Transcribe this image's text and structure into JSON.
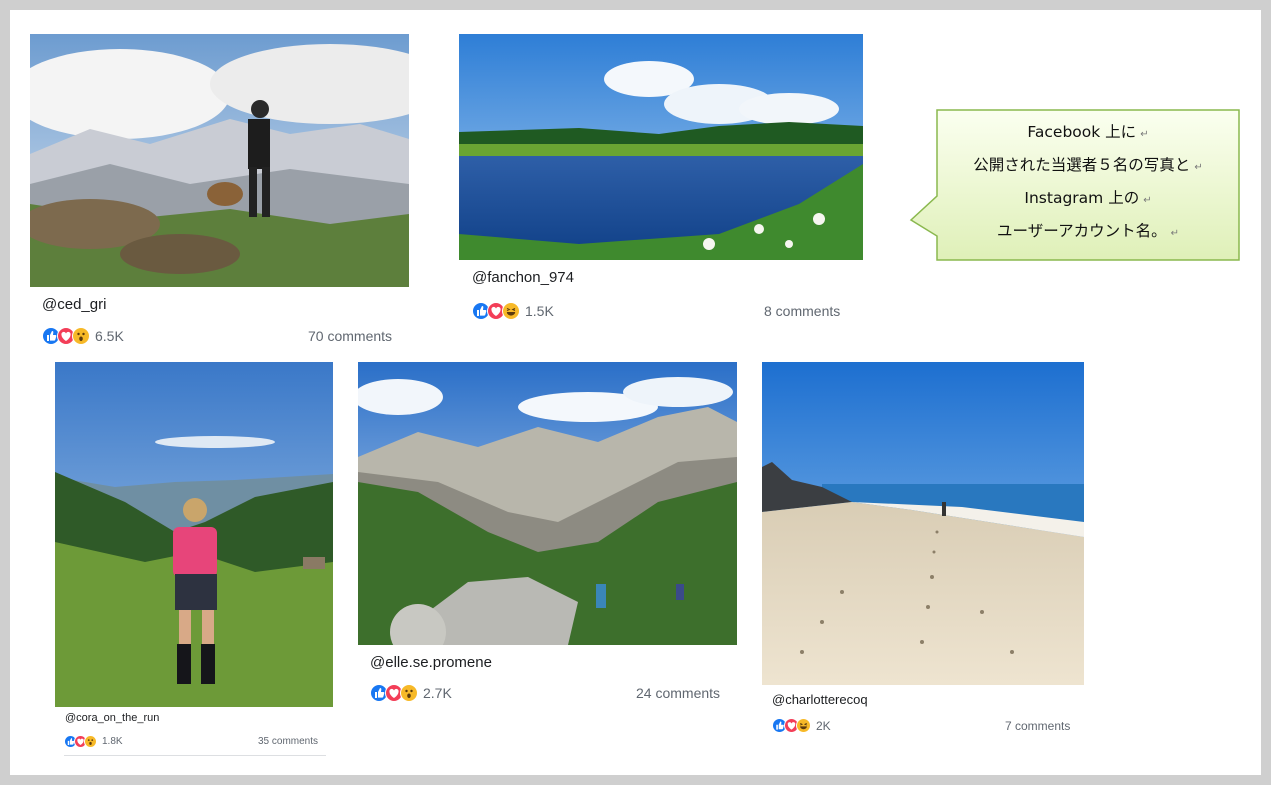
{
  "posts": [
    {
      "username": "@ced_gri",
      "count": "6.5K",
      "comments": "70 comments",
      "reactions": [
        "like",
        "love",
        "wow"
      ]
    },
    {
      "username": "@fanchon_974",
      "count": "1.5K",
      "comments": "8 comments",
      "reactions": [
        "like",
        "love",
        "haha"
      ]
    },
    {
      "username": "@cora_on_the_run",
      "count": "1.8K",
      "comments": "35 comments",
      "reactions": [
        "like",
        "love",
        "wow"
      ]
    },
    {
      "username": "@elle.se.promene",
      "count": "2.7K",
      "comments": "24 comments",
      "reactions": [
        "like",
        "love",
        "wow"
      ]
    },
    {
      "username": "@charlotterecoq",
      "count": "2K",
      "comments": "7 comments",
      "reactions": [
        "like",
        "love",
        "haha"
      ]
    }
  ],
  "callout": {
    "lines": [
      "Facebook 上に",
      "公開された当選者５名の写真と",
      "Instagram 上の",
      "ユーザーアカウント名。"
    ],
    "return_mark": "↵"
  },
  "colors": {
    "like": "#1877f2",
    "love": "#f33e58",
    "wow": "#f7b928",
    "callout_fill": "#eef8d6",
    "callout_border": "#8ab84e"
  }
}
